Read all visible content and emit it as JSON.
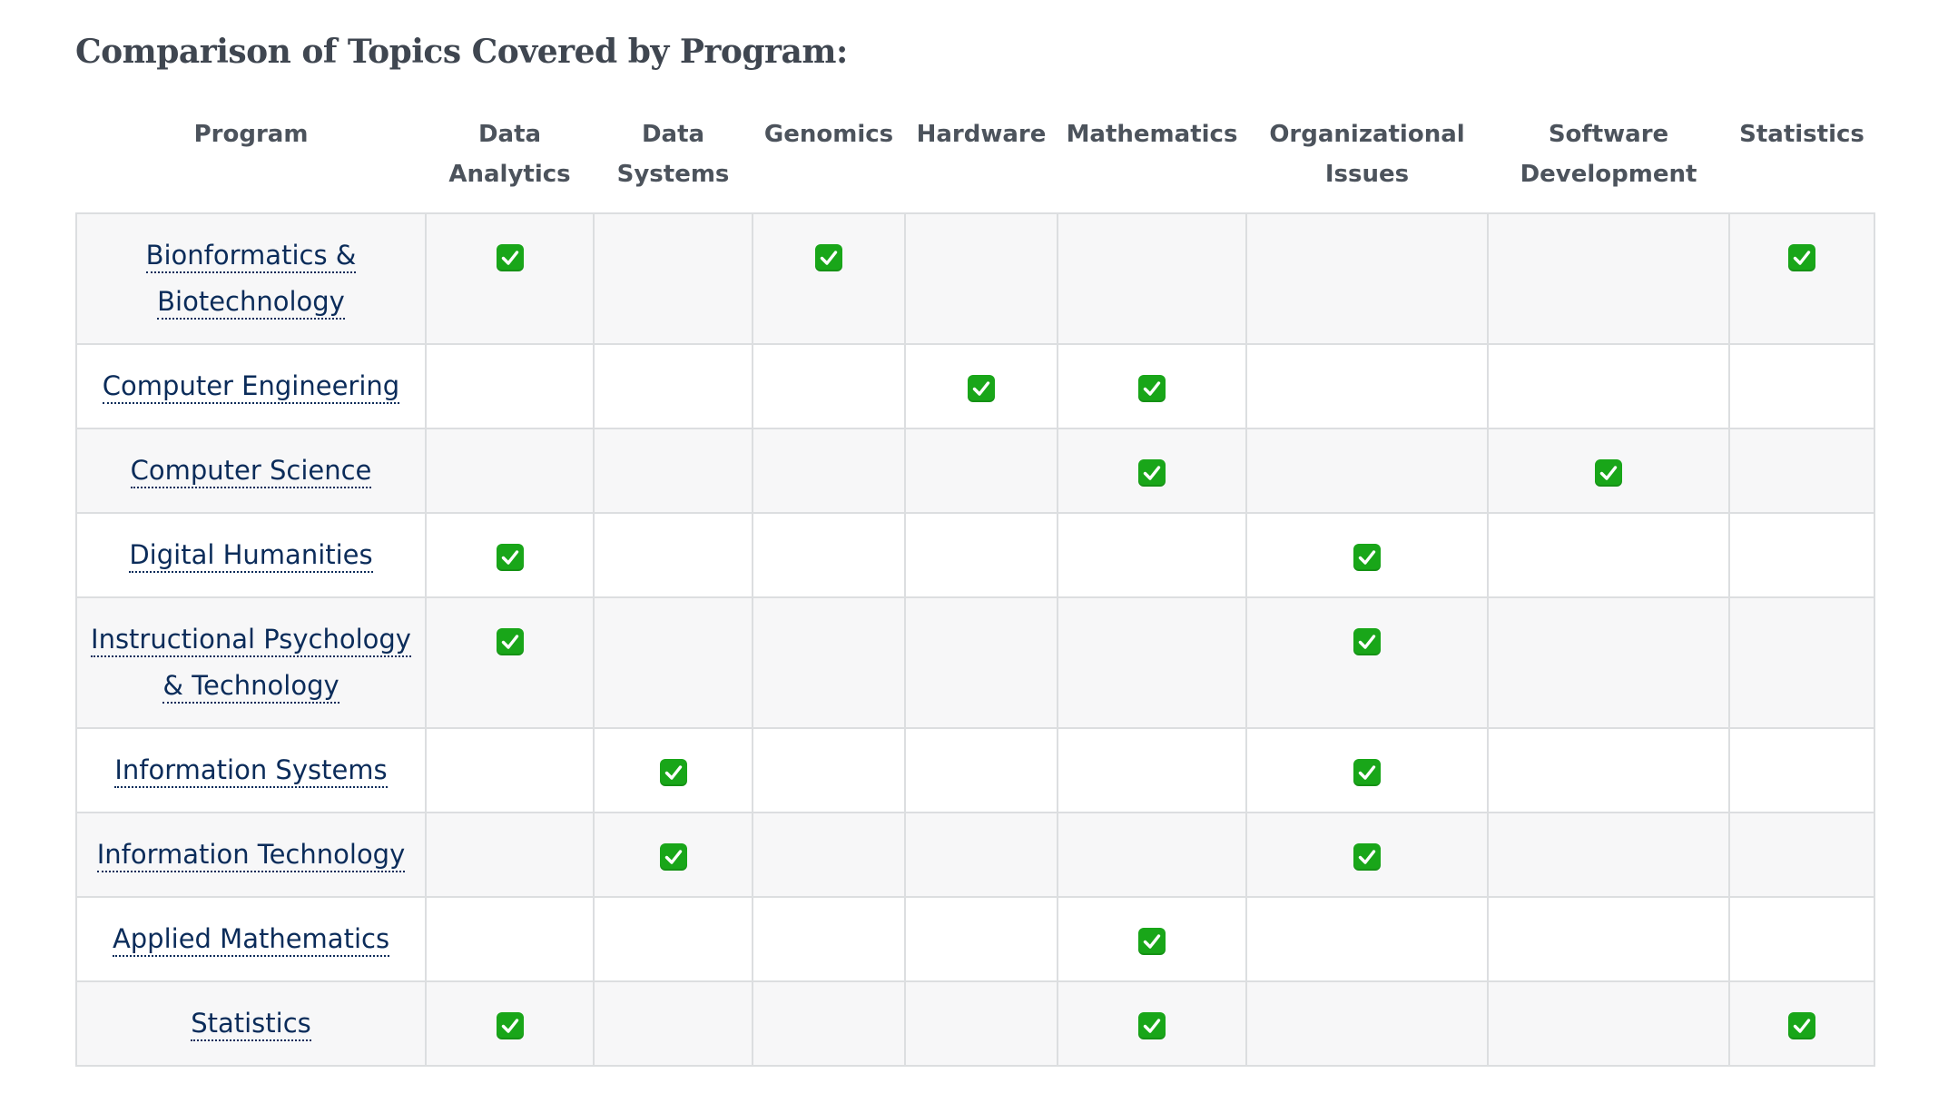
{
  "heading": "Comparison of Topics Covered by Program:",
  "columns": {
    "program": "Program",
    "data_analytics": "Data Analytics",
    "data_systems": "Data Systems",
    "genomics": "Genomics",
    "hardware": "Hardware",
    "mathematics": "Mathematics",
    "organizational_issues": "Organizational Issues",
    "software_development": "Software Development",
    "statistics": "Statistics"
  },
  "check_icon": "white-heavy-check-mark-icon",
  "colors": {
    "check_bg": "#19a619",
    "link": "#0b2c5a",
    "border": "#dcdee0",
    "stripe": "#f7f7f8"
  },
  "rows": [
    {
      "program": "Bionformatics & Biotechnology",
      "covered": [
        "data_analytics",
        "genomics",
        "statistics"
      ]
    },
    {
      "program": "Computer Engineering",
      "covered": [
        "hardware",
        "mathematics"
      ]
    },
    {
      "program": "Computer Science",
      "covered": [
        "mathematics",
        "software_development"
      ]
    },
    {
      "program": "Digital Humanities",
      "covered": [
        "data_analytics",
        "organizational_issues"
      ]
    },
    {
      "program": "Instructional Psychology & Technology",
      "covered": [
        "data_analytics",
        "organizational_issues"
      ]
    },
    {
      "program": "Information Systems",
      "covered": [
        "data_systems",
        "organizational_issues"
      ]
    },
    {
      "program": "Information Technology",
      "covered": [
        "data_systems",
        "organizational_issues"
      ]
    },
    {
      "program": "Applied Mathematics",
      "covered": [
        "mathematics"
      ]
    },
    {
      "program": "Statistics",
      "covered": [
        "data_analytics",
        "mathematics",
        "statistics"
      ]
    }
  ]
}
